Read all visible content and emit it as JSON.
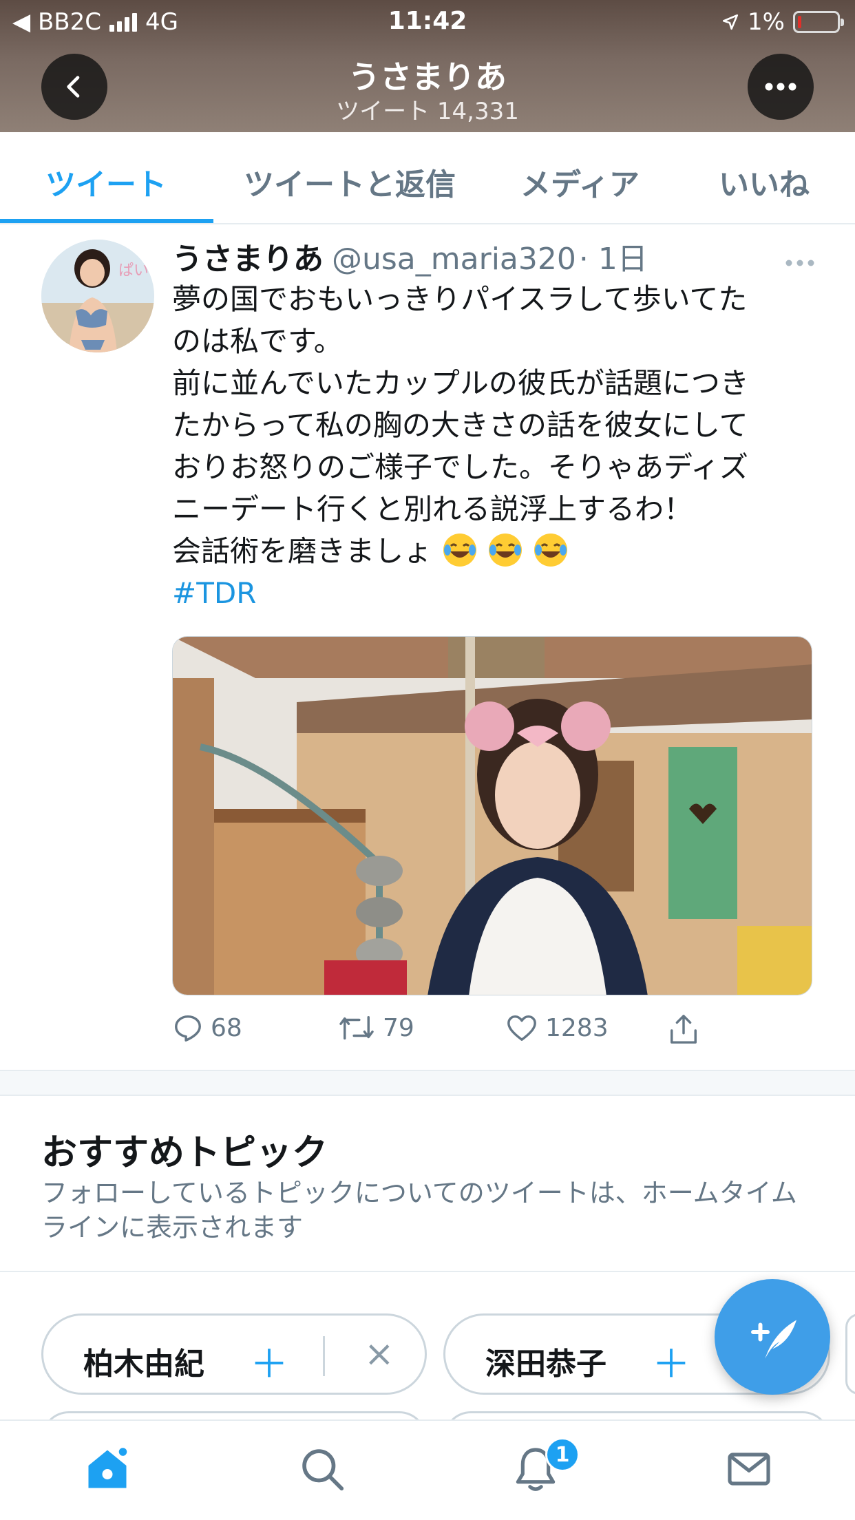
{
  "status_bar": {
    "back_app": "◀ BB2C",
    "network": "4G",
    "time": "11:42",
    "battery": "1%"
  },
  "header": {
    "title": "うさまりあ",
    "subtitle": "ツイート 14,331"
  },
  "tabs": [
    {
      "label": "ツイート",
      "active": true
    },
    {
      "label": "ツイートと返信",
      "active": false
    },
    {
      "label": "メディア",
      "active": false
    },
    {
      "label": "いいね",
      "active": false
    }
  ],
  "tweet": {
    "name": "うさまりあ",
    "handle": "@usa_maria320",
    "time": "· 1日",
    "lines": [
      "夢の国でおもいっきりパイスラして歩いてた",
      "のは私です。",
      "前に並んでいたカップルの彼氏が話題につき",
      "たからって私の胸の大きさの話を彼女にして",
      "おりお怒りのご様子でした。そりゃあディズ",
      "ニーデート行くと別れる説浮上するわ！",
      "会話術を磨きましょ"
    ],
    "hashtag": "#TDR",
    "actions": {
      "reply_count": "68",
      "retweet_count": "79",
      "like_count": "1283"
    }
  },
  "topics": {
    "title": "おすすめトピック",
    "description": "フォローしているトピックについてのツイートは、ホームタイムラインに表示されます",
    "chips": [
      "柏木由紀",
      "深田恭子"
    ]
  },
  "bottom_nav": {
    "notification_badge": "1"
  },
  "colors": {
    "accent": "#1da1f2",
    "text_secondary": "#657786"
  }
}
